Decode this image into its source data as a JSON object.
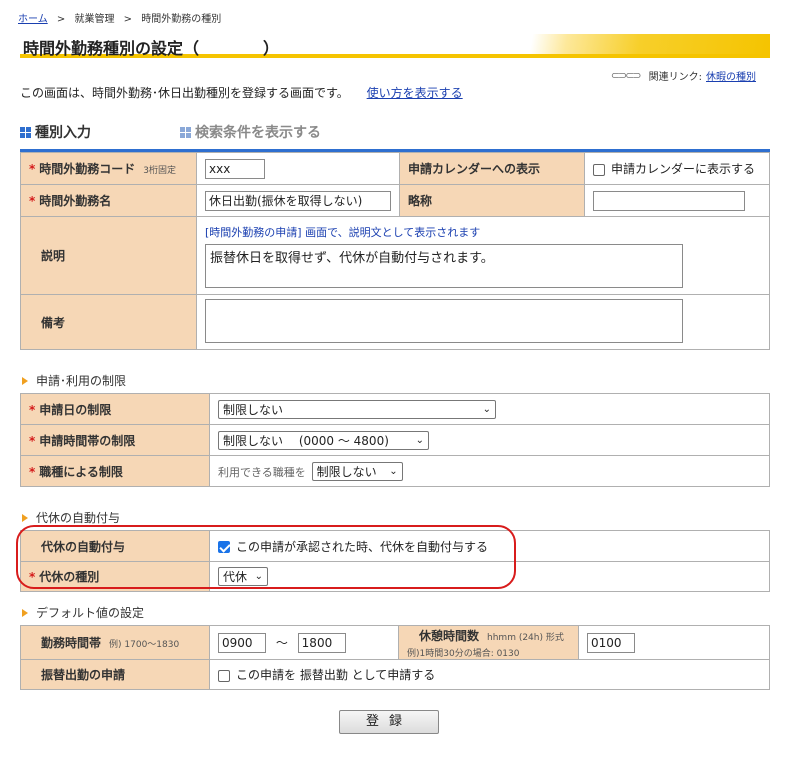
{
  "breadcrumb": {
    "home": "ホーム",
    "sep": ">",
    "level2": "就業管理",
    "current": "時間外勤務の種別"
  },
  "page_title": "時間外勤務種別の設定（　　　　）",
  "related": {
    "label": "関連リンク:",
    "link": "休暇の種別",
    "icon": "link-chain-icon"
  },
  "description": {
    "text": "この画面は、時間外勤務･休日出勤種別を登録する画面です。",
    "help_link": "使い方を表示する"
  },
  "tabs": {
    "active": "種別入力",
    "search": "検索条件を表示する"
  },
  "basic": {
    "code_label": "時間外勤務コード",
    "code_hint": "3桁固定",
    "code_value": "xxx",
    "calendar_label": "申請カレンダーへの表示",
    "calendar_checkbox_label": "申請カレンダーに表示する",
    "name_label": "時間外勤務名",
    "name_value": "休日出勤(振休を取得しない)",
    "abbr_label": "略称",
    "abbr_value": "",
    "explain_label": "説明",
    "explain_note": "[時間外勤務の申請] 画面で、説明文として表示されます",
    "explain_value": "振替休日を取得せず、代休が自動付与されます。",
    "remarks_label": "備考",
    "remarks_value": ""
  },
  "restrictions": {
    "heading": "申請･利用の制限",
    "date_label": "申請日の制限",
    "date_value": "制限しない",
    "time_label": "申請時間帯の制限",
    "time_value": "制限しない　 (0000 ～ 4800)",
    "job_label": "職種による制限",
    "job_prefix": "利用できる職種を",
    "job_value": "制限しない"
  },
  "comp_leave": {
    "heading": "代休の自動付与",
    "auto_label": "代休の自動付与",
    "auto_checkbox_label": "この申請が承認された時、代休を自動付与する",
    "auto_checked": true,
    "type_label": "代休の種別",
    "type_value": "代休"
  },
  "defaults": {
    "heading": "デフォルト値の設定",
    "work_label": "勤務時間帯",
    "work_hint": "例) 1700～1830",
    "work_from": "0900",
    "work_sep": "～",
    "work_to": "1800",
    "break_label": "休憩時間数",
    "break_hint": "hhmm (24h) 形式",
    "break_example": "例)1時間30分の場合: 0130",
    "break_value": "0100",
    "transfer_label": "振替出勤の申請",
    "transfer_checkbox_label": "この申請を 振替出勤 として申請する"
  },
  "submit_label": "登録",
  "colors": {
    "label_bg": "#f6d7b6",
    "required": "#d41a1a",
    "tab_border": "#2e6fd0",
    "title_stripe": "#f5c400",
    "highlight": "#d81c1c"
  }
}
